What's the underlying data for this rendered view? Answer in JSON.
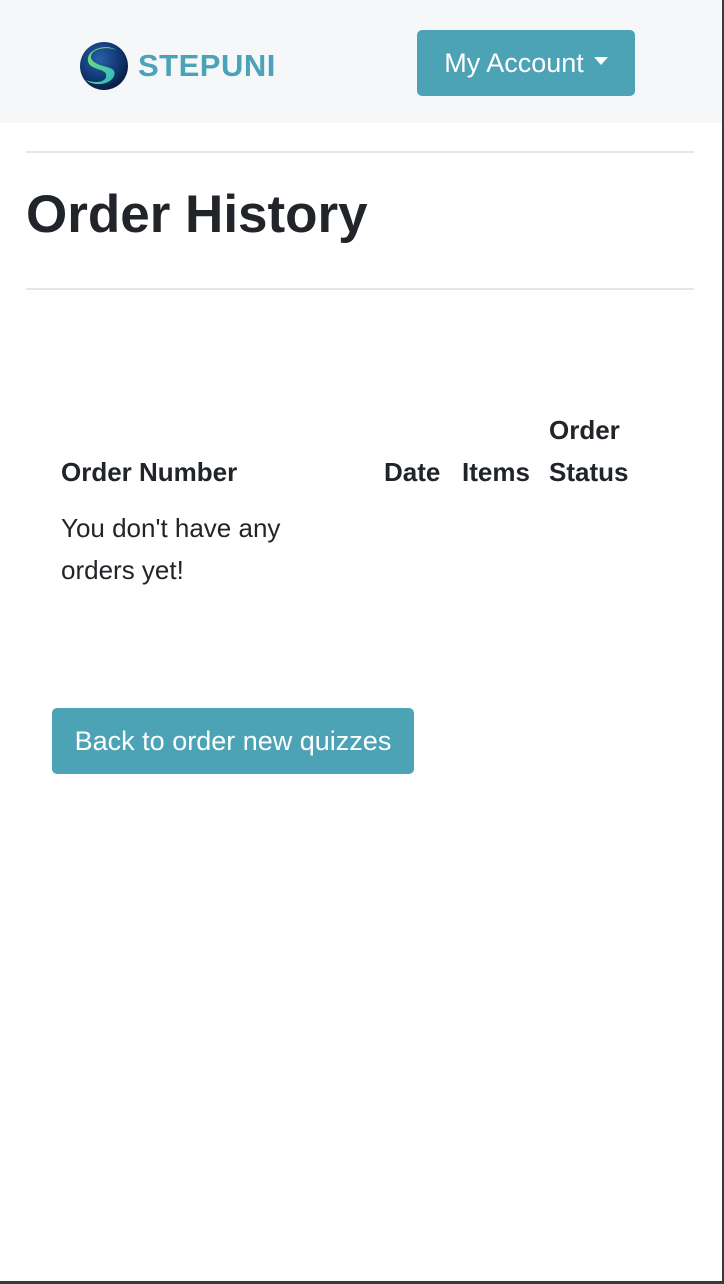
{
  "brand": {
    "name": "STEPUNI",
    "logo_icon": "stepuni-globe-logo",
    "color": "#4aa3b8"
  },
  "navbar": {
    "account_label": "My Account",
    "account_icon": "caret-down-icon",
    "button_color": "#4ca3b6",
    "background": "#f6f7f9"
  },
  "page": {
    "title": "Order History"
  },
  "table": {
    "columns": [
      "Order Number",
      "Date",
      "Items",
      "Order Status"
    ],
    "empty_message": "You don't have any orders yet!"
  },
  "actions": {
    "back_label": "Back to order new quizzes"
  }
}
